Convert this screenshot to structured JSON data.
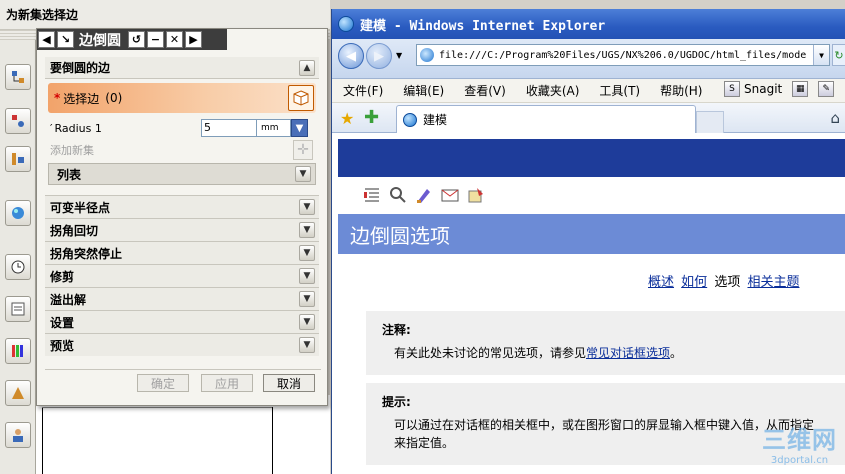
{
  "nx": {
    "title": "为新集选择边"
  },
  "dialog": {
    "title": "边倒圆",
    "section_edges": "要倒圆的边",
    "select_edge_label": "选择边",
    "select_edge_count": "(0)",
    "radius_label": "Radius 1",
    "radius_value": "5",
    "radius_unit": "mm",
    "add_new_set": "添加新集",
    "list_label": "列表",
    "sections": [
      "可变半径点",
      "拐角回切",
      "拐角突然停止",
      "修剪",
      "溢出解",
      "设置",
      "预览"
    ],
    "ok": "确定",
    "apply": "应用",
    "cancel": "取消"
  },
  "ie": {
    "window_title": "建模 - Windows Internet Explorer",
    "url": "file:///C:/Program%20Files/UGS/NX%206.0/UGDOC/html_files/mode",
    "menu": [
      "文件(F)",
      "编辑(E)",
      "查看(V)",
      "收藏夹(A)",
      "工具(T)",
      "帮助(H)"
    ],
    "snagit": "Snagit",
    "tab_title": "建模",
    "page_title": "边倒圆选项",
    "crumbs": {
      "overview": "概述",
      "howto": "如何",
      "options": "选项",
      "related": "相关主题"
    },
    "note": {
      "heading": "注释:",
      "text": "有关此处未讨论的常见选项，请参见",
      "link": "常见对话框选项",
      "end": "。"
    },
    "tip": {
      "heading": "提示:",
      "line1": "可以通过在对话框的相关框中，或在图形窗口的屏显输入框中键入值，从而指定",
      "line2": "来指定值。"
    }
  },
  "watermark": {
    "main": "三维网",
    "sub": "3dportal.cn"
  }
}
